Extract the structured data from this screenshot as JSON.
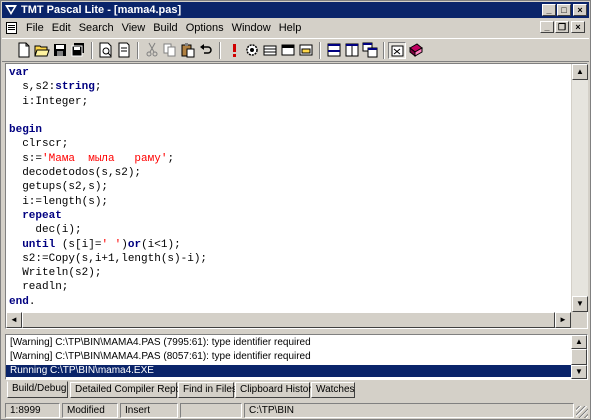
{
  "window": {
    "title": "TMT Pascal Lite - [mama4.pas]",
    "min_label": "_",
    "max_label": "□",
    "close_label": "×"
  },
  "menu": {
    "items": [
      "File",
      "Edit",
      "Search",
      "View",
      "Build",
      "Options",
      "Window",
      "Help"
    ],
    "mdi_min": "_",
    "mdi_restore": "❐",
    "mdi_close": "×"
  },
  "toolbar": {
    "tools": [
      "new-file",
      "open-file",
      "save",
      "save-all",
      "print-preview",
      "print",
      "cut",
      "copy",
      "paste",
      "undo",
      "run",
      "compile",
      "build",
      "make",
      "debug",
      "split-horizontal",
      "split-vertical",
      "tile-windows",
      "compile-options",
      "help-book"
    ]
  },
  "editor": {
    "lines": [
      [
        {
          "t": "var",
          "c": "kw"
        }
      ],
      [
        {
          "t": "  s,s2:"
        },
        {
          "t": "string",
          "c": "kw"
        },
        {
          "t": ";"
        }
      ],
      [
        {
          "t": "  i:Integer;"
        }
      ],
      [
        {
          "t": ""
        }
      ],
      [
        {
          "t": "begin",
          "c": "kw"
        }
      ],
      [
        {
          "t": "  clrscr;"
        }
      ],
      [
        {
          "t": "  s:="
        },
        {
          "t": "'Мама  мыла   раму'",
          "c": "str"
        },
        {
          "t": ";"
        }
      ],
      [
        {
          "t": "  decodetodos(s,s2);"
        }
      ],
      [
        {
          "t": "  getups(s2,s);"
        }
      ],
      [
        {
          "t": "  i:=length(s);"
        }
      ],
      [
        {
          "t": "  "
        },
        {
          "t": "repeat",
          "c": "kw"
        }
      ],
      [
        {
          "t": "    dec(i);"
        }
      ],
      [
        {
          "t": "  "
        },
        {
          "t": "until",
          "c": "kw"
        },
        {
          "t": " (s[i]="
        },
        {
          "t": "' '",
          "c": "str"
        },
        {
          "t": ")"
        },
        {
          "t": "or",
          "c": "kw"
        },
        {
          "t": "(i<1);"
        }
      ],
      [
        {
          "t": "  s2:=Copy(s,i+1,length(s)-i);"
        }
      ],
      [
        {
          "t": "  Writeln(s2);"
        }
      ],
      [
        {
          "t": "  readln;"
        }
      ],
      [
        {
          "t": "end",
          "c": "kw"
        },
        {
          "t": "."
        }
      ]
    ],
    "scroll_up": "▲",
    "scroll_down": "▼",
    "scroll_left": "◄",
    "scroll_right": "►"
  },
  "messages": {
    "lines": [
      "[Warning] C:\\TP\\BIN\\MAMA4.PAS (7995:61): type identifier required",
      "[Warning] C:\\TP\\BIN\\MAMA4.PAS (8057:61): type identifier required",
      "Running C:\\TP\\BIN\\mama4.EXE"
    ]
  },
  "tabs": [
    "Build/Debug",
    "Detailed Compiler Report",
    "Find in Files",
    "Clipboard History",
    "Watches"
  ],
  "status": {
    "position": "1:8999",
    "modified": "Modified",
    "mode": "Insert",
    "blank": "",
    "path": "C:\\TP\\BIN"
  }
}
